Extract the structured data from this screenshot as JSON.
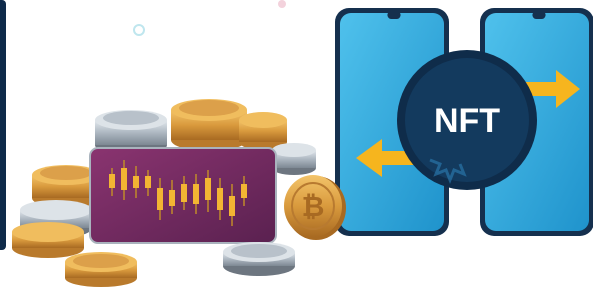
{
  "illustration": {
    "nft_label": "NFT",
    "icons": {
      "coin": "bitcoin-coin-icon",
      "chart": "candlestick-chart-icon",
      "arrow_right": "arrow-right-icon",
      "arrow_left": "arrow-left-icon",
      "phone": "smartphone-icon"
    },
    "colors": {
      "phone_blue": "#2aa7df",
      "phone_dark": "#123a5c",
      "badge_navy": "#103557",
      "badge_text": "#ffffff",
      "arrow_yellow": "#f6b51e",
      "gold": "#d89a3a",
      "silver": "#a9b3bd",
      "chart_bg": "#7a2f63"
    }
  }
}
